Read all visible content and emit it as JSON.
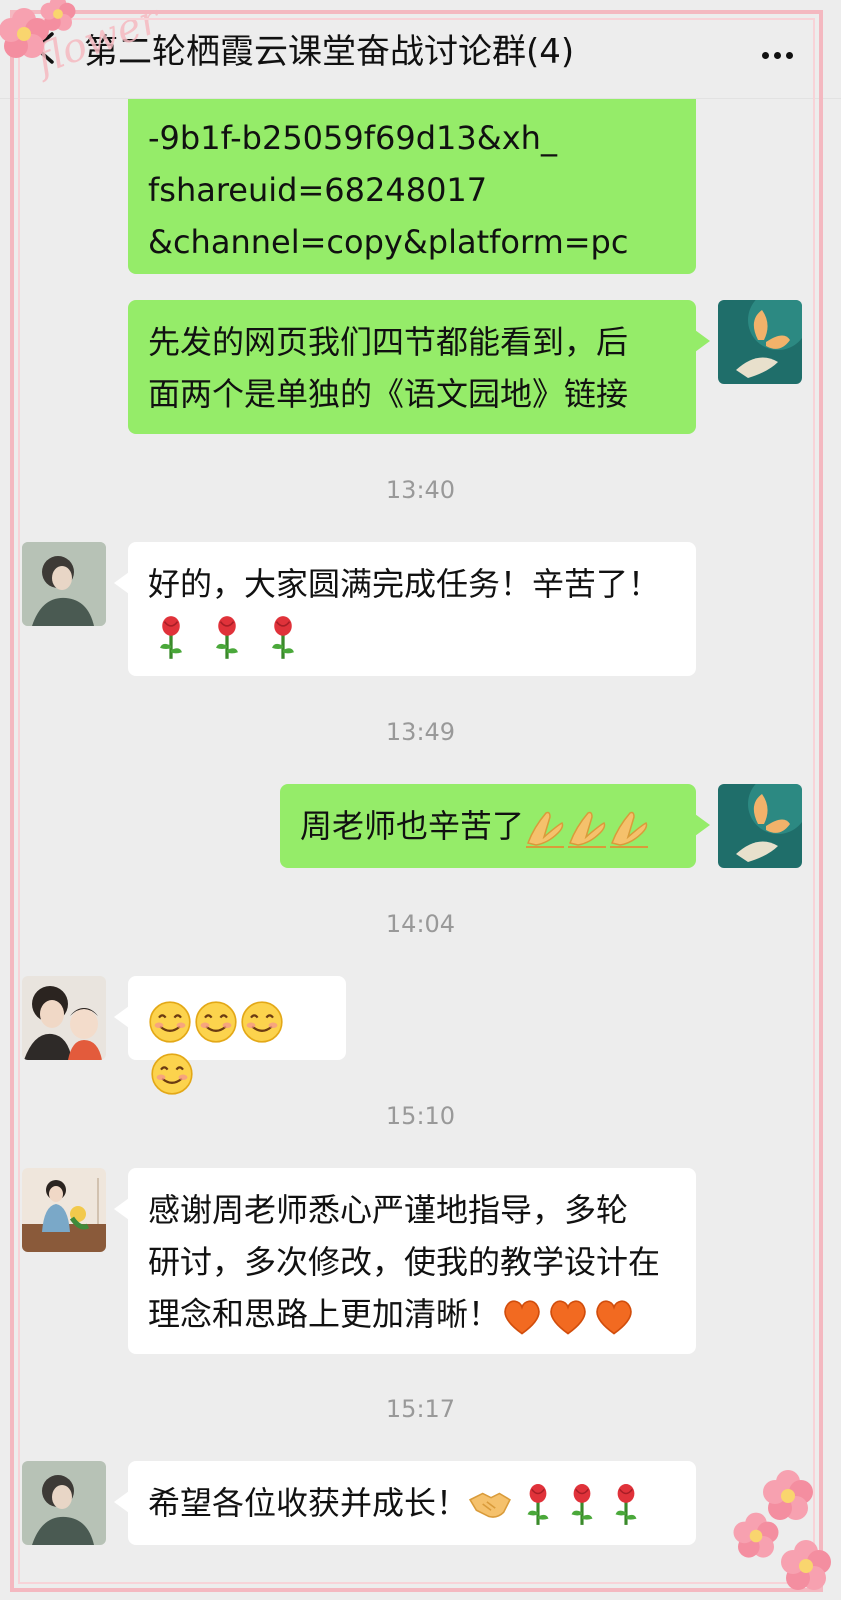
{
  "header": {
    "title": "第二轮栖霞云课堂奋战讨论群(4)"
  },
  "decoration": {
    "watermark_text": "flower",
    "frame_color": "#f4b8c0"
  },
  "messages": [
    {
      "side": "right",
      "text_lines": [
        "-9b1f-b25059f69d13&xh_",
        "fshareuid=68248017",
        "&channel=copy&platform=pc"
      ]
    },
    {
      "side": "right",
      "text_lines": [
        "先发的网页我们四节都能看到，后",
        "面两个是单独的《语文园地》链接"
      ]
    },
    {
      "time": "13:40"
    },
    {
      "side": "left",
      "text_lines": [
        "好的，大家圆满完成任务！辛苦了！"
      ],
      "emojis": [
        "rose-icon",
        "rose-icon",
        "rose-icon"
      ]
    },
    {
      "time": "13:49"
    },
    {
      "side": "right",
      "text_lines": [
        "周老师也辛苦了"
      ],
      "emojis": [
        "pray-icon",
        "pray-icon",
        "pray-icon"
      ]
    },
    {
      "time": "14:04"
    },
    {
      "side": "left",
      "emojis": [
        "smile-icon",
        "smile-icon",
        "smile-icon",
        "smile-icon"
      ]
    },
    {
      "time": "15:10"
    },
    {
      "side": "left",
      "text_lines": [
        "感谢周老师悉心严谨地指导，多轮",
        "研讨，多次修改，使我的教学设计在",
        "理念和思路上更加清晰！"
      ],
      "emojis": [
        "heart-icon",
        "heart-icon",
        "heart-icon"
      ]
    },
    {
      "time": "15:17"
    },
    {
      "side": "left",
      "text_lines": [
        "希望各位收获并成长！"
      ],
      "emojis": [
        "handshake-icon",
        "rose-icon",
        "rose-icon",
        "rose-icon"
      ]
    }
  ],
  "times": {
    "t1": "13:40",
    "t2": "13:49",
    "t3": "14:04",
    "t4": "15:10",
    "t5": "15:17"
  },
  "texts": {
    "m1_l1": "-9b1f-b25059f69d13&xh_",
    "m1_l2": "fshareuid=68248017",
    "m1_l3": "&channel=copy&platform=pc",
    "m2_l1": "先发的网页我们四节都能看到，后",
    "m2_l2": "面两个是单独的《语文园地》链接",
    "m3_l1": "好的，大家圆满完成任务！辛苦了！",
    "m4_l1": "周老师也辛苦了",
    "m6_l1": "感谢周老师悉心严谨地指导，多轮",
    "m6_l2": "研讨，多次修改，使我的教学设计在",
    "m6_l3": "理念和思路上更加清晰！",
    "m7_l1": "希望各位收获并成长！"
  },
  "colors": {
    "sent_bubble": "#95ec69",
    "received_bubble": "#ffffff",
    "background": "#ededed",
    "timestamp": "#999999"
  }
}
